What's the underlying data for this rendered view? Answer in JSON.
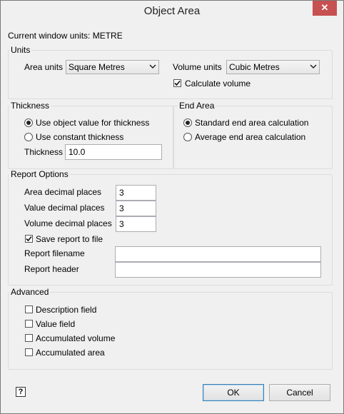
{
  "window": {
    "title": "Object Area",
    "close_label": "✕"
  },
  "units_line": "Current window units: METRE",
  "units": {
    "group_label": "Units",
    "area_label": "Area units",
    "area_value": "Square Metres",
    "volume_label": "Volume units",
    "volume_value": "Cubic Metres",
    "calc_volume_label": "Calculate volume",
    "calc_volume_checked": true
  },
  "thickness": {
    "group_label": "Thickness",
    "option1": "Use object value for thickness",
    "option2": "Use constant thickness",
    "selected": 1,
    "field_label": "Thickness",
    "field_value": "10.0"
  },
  "end_area": {
    "group_label": "End Area",
    "option1": "Standard end area calculation",
    "option2": "Average end area calculation",
    "selected": 1
  },
  "report": {
    "group_label": "Report Options",
    "area_dp_label": "Area decimal places",
    "area_dp_value": "3",
    "value_dp_label": "Value decimal places",
    "value_dp_value": "3",
    "volume_dp_label": "Volume decimal places",
    "volume_dp_value": "3",
    "save_label": "Save report to file",
    "save_checked": true,
    "filename_label": "Report filename",
    "filename_value": "",
    "header_label": "Report header",
    "header_value": ""
  },
  "advanced": {
    "group_label": "Advanced",
    "description_label": "Description field",
    "value_label": "Value field",
    "acc_volume_label": "Accumulated volume",
    "acc_area_label": "Accumulated area"
  },
  "buttons": {
    "ok": "OK",
    "cancel": "Cancel"
  },
  "icons": {
    "help": "help-icon",
    "checkmark": "check-icon",
    "dropdown": "chevron-down-icon",
    "close": "close-icon"
  }
}
